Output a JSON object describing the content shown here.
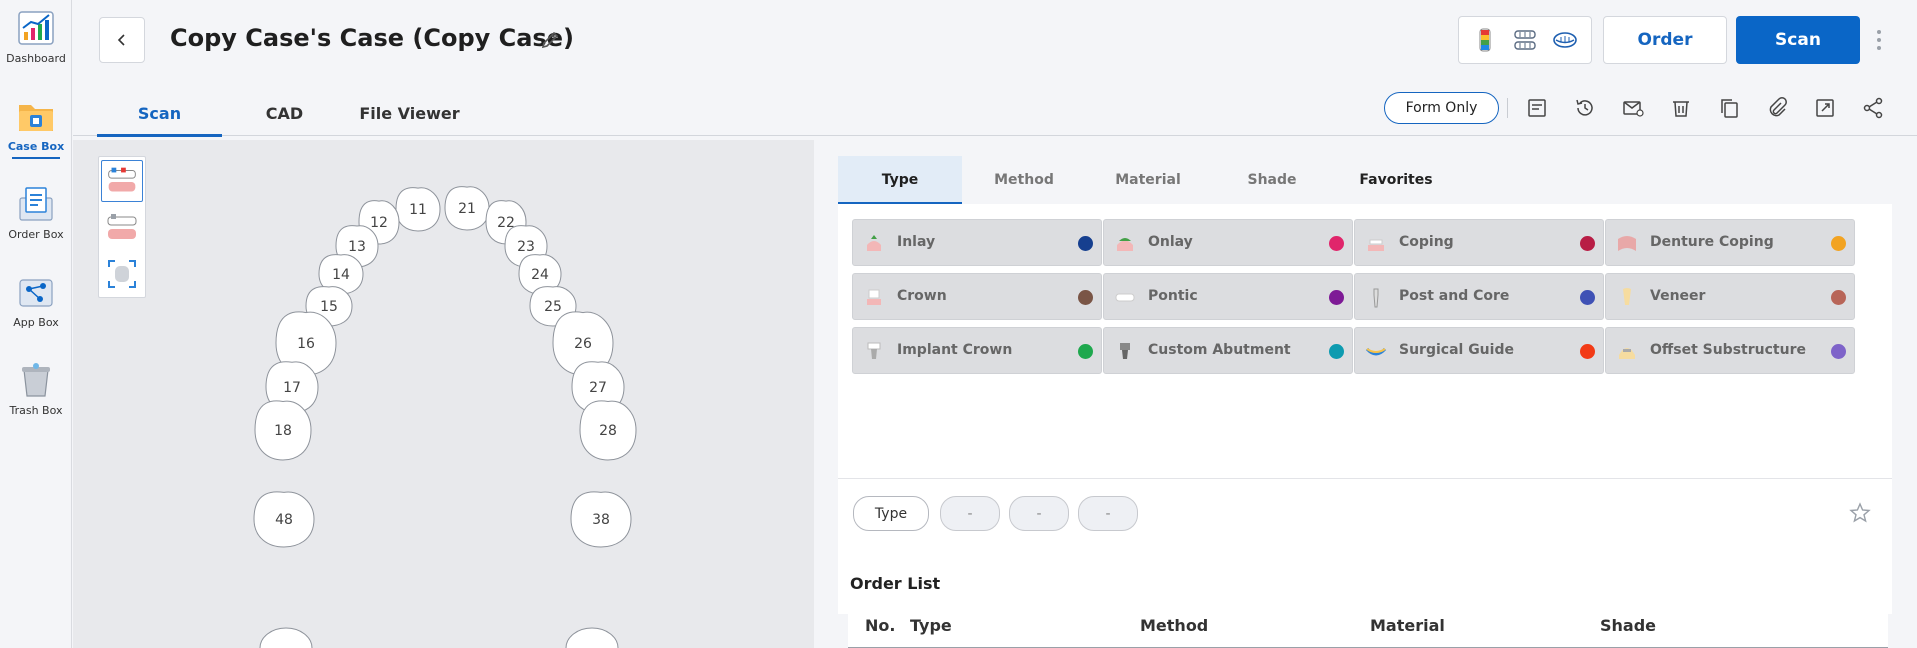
{
  "rail": {
    "items": [
      {
        "label": "Dashboard",
        "icon": "dashboard-chart-icon"
      },
      {
        "label": "Case Box",
        "icon": "case-box-folder-icon"
      },
      {
        "label": "Order Box",
        "icon": "order-box-icon"
      },
      {
        "label": "App Box",
        "icon": "app-box-icon"
      },
      {
        "label": "Trash Box",
        "icon": "trash-box-icon"
      }
    ],
    "active": "Case Box"
  },
  "header": {
    "case_title": "Copy Case's Case (Copy Case)",
    "order_label": "Order",
    "scan_label": "Scan",
    "form_only_label": "Form Only",
    "tabs": [
      "Scan",
      "CAD",
      "File Viewer"
    ],
    "active_tab": "Scan"
  },
  "right": {
    "tabs": [
      "Type",
      "Method",
      "Material",
      "Shade",
      "Favorites"
    ],
    "active_tab": "Type",
    "types": [
      {
        "label": "Inlay",
        "color": "#163f8f"
      },
      {
        "label": "Onlay",
        "color": "#e0256b"
      },
      {
        "label": "Coping",
        "color": "#b81d45"
      },
      {
        "label": "Denture Coping",
        "color": "#f2a322"
      },
      {
        "label": "Crown",
        "color": "#7a5546"
      },
      {
        "label": "Pontic",
        "color": "#7e1a96"
      },
      {
        "label": "Post and Core",
        "color": "#3f51b5"
      },
      {
        "label": "Veneer",
        "color": "#b86558"
      },
      {
        "label": "Implant Crown",
        "color": "#1fa84e"
      },
      {
        "label": "Custom Abutment",
        "color": "#0e9bb0"
      },
      {
        "label": "Surgical Guide",
        "color": "#f23a16"
      },
      {
        "label": "Offset Substructure",
        "color": "#7e63c9"
      }
    ],
    "summary": {
      "type_chip": "Type",
      "method_chip": "-",
      "material_chip": "-",
      "shade_chip": "-"
    },
    "order_list": {
      "title": "Order List",
      "columns": [
        "No.",
        "Type",
        "Method",
        "Material",
        "Shade"
      ]
    }
  },
  "teeth": {
    "upper_left": [
      "11",
      "12",
      "13",
      "14",
      "15",
      "16",
      "17",
      "18"
    ],
    "upper_right": [
      "21",
      "22",
      "23",
      "24",
      "25",
      "26",
      "27",
      "28"
    ],
    "lower": [
      "48",
      "38"
    ]
  }
}
